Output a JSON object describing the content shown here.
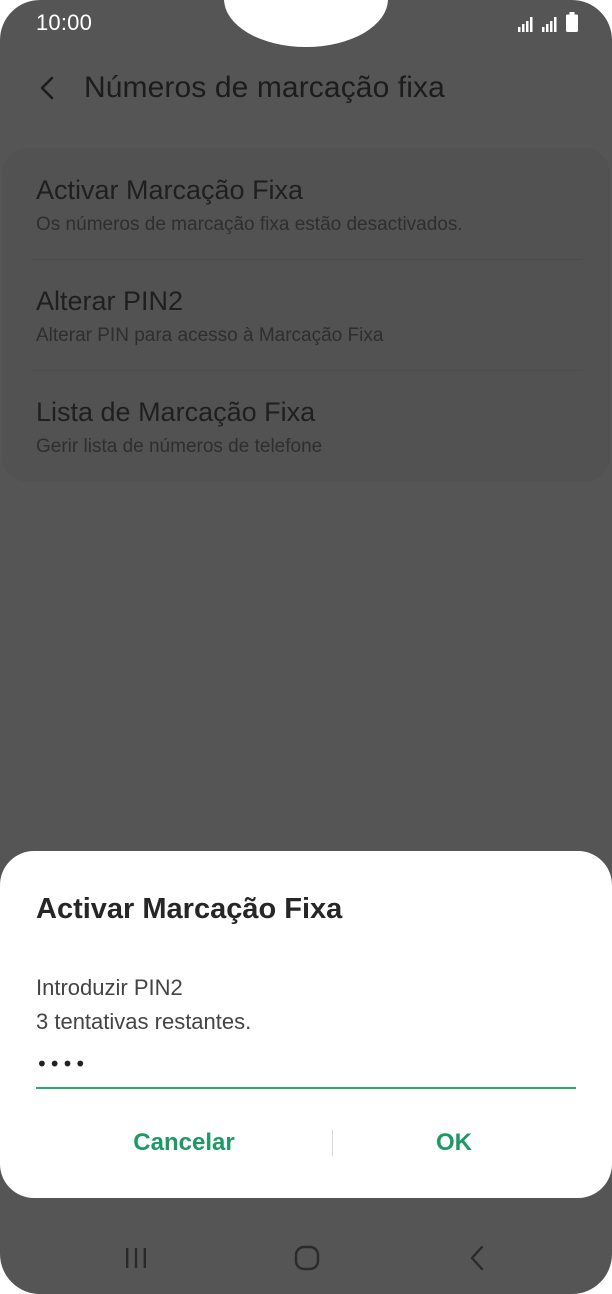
{
  "status_bar": {
    "time": "10:00",
    "icons": [
      "signal-sim1-icon",
      "signal-sim2-icon",
      "battery-icon"
    ]
  },
  "app_bar": {
    "back_icon": "chevron-left-icon",
    "title": "Números de marcação fixa"
  },
  "settings": {
    "items": [
      {
        "title": "Activar Marcação Fixa",
        "subtitle": "Os números de marcação fixa estão desactivados."
      },
      {
        "title": "Alterar PIN2",
        "subtitle": "Alterar PIN para acesso à Marcação Fixa"
      },
      {
        "title": "Lista de Marcação Fixa",
        "subtitle": "Gerir lista de números de telefone"
      }
    ]
  },
  "dialog": {
    "title": "Activar Marcação Fixa",
    "message_line1": "Introduzir PIN2",
    "message_line2": "3 tentativas restantes.",
    "pin_value": "••••",
    "cancel_label": "Cancelar",
    "ok_label": "OK"
  },
  "nav_bar": {
    "icons": [
      "recent-apps-icon",
      "home-icon",
      "back-icon"
    ]
  },
  "colors": {
    "scrim": "#555555",
    "accent": "#1d9a63",
    "dialog_bg": "#ffffff"
  }
}
